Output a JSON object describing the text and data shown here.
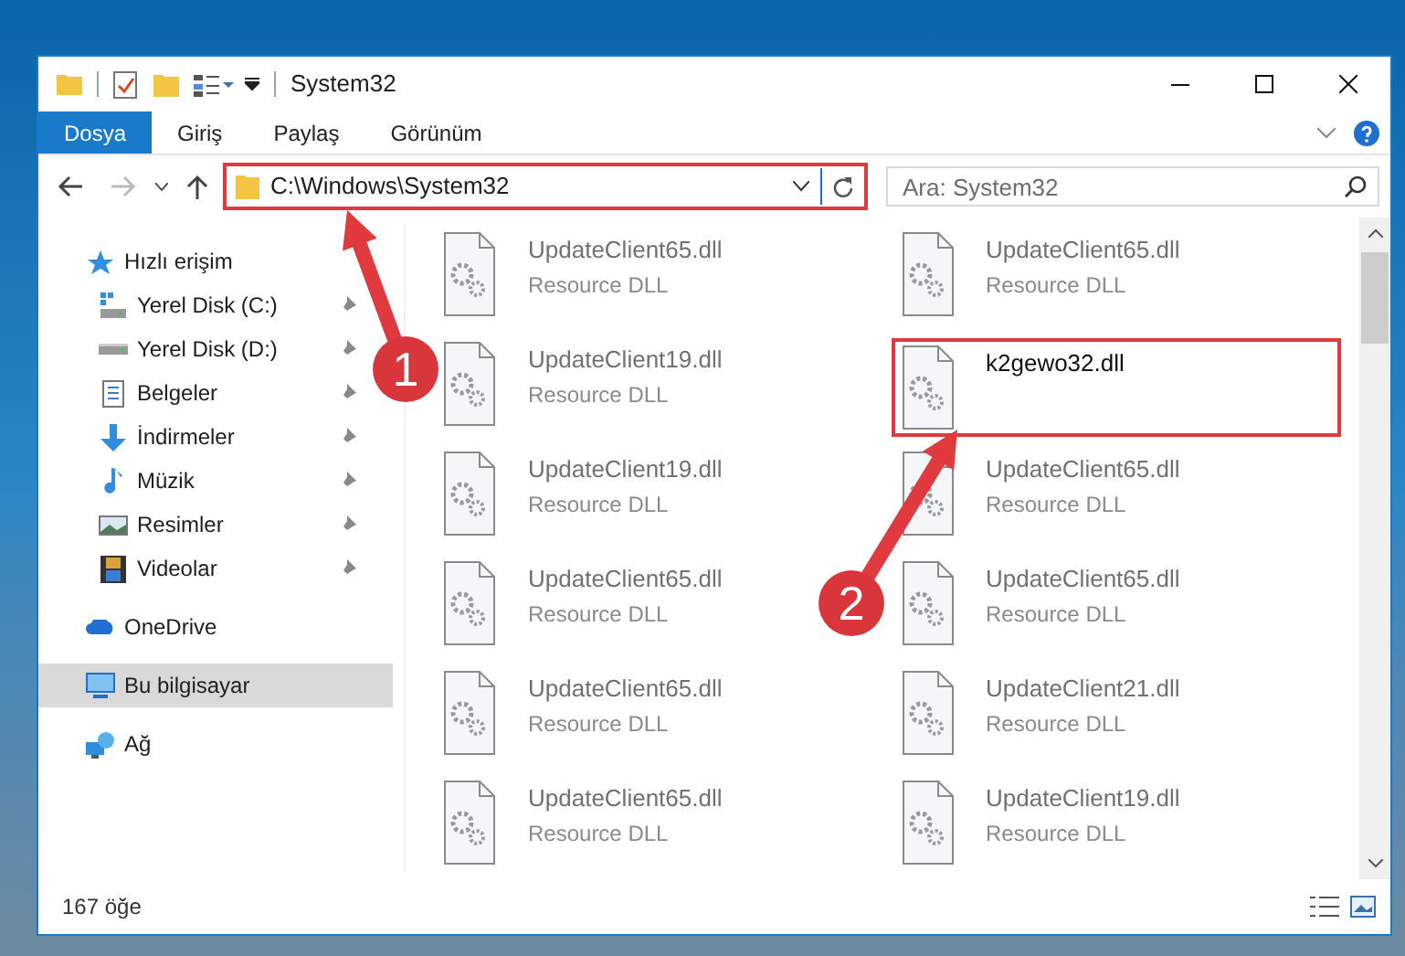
{
  "window": {
    "title": "System32"
  },
  "ribbon_tabs": [
    {
      "label": "Dosya",
      "kind": "file"
    },
    {
      "label": "Giriş",
      "kind": "tab"
    },
    {
      "label": "Paylaş",
      "kind": "tab"
    },
    {
      "label": "Görünüm",
      "kind": "tab"
    }
  ],
  "address_bar": {
    "path": "C:\\Windows\\System32",
    "highlighted": true
  },
  "search": {
    "placeholder": "Ara: System32"
  },
  "sidebar": {
    "items": [
      {
        "label": "Hızlı erişim",
        "selected": false,
        "children": [
          {
            "label": "Yerel Disk (C:)",
            "pinned": true,
            "selected": false
          },
          {
            "label": "Yerel Disk (D:)",
            "pinned": true,
            "selected": false
          },
          {
            "label": "Belgeler",
            "pinned": true,
            "selected": false
          },
          {
            "label": "İndirmeler",
            "pinned": true,
            "selected": false
          },
          {
            "label": "Müzik",
            "pinned": true,
            "selected": false
          },
          {
            "label": "Resimler",
            "pinned": true,
            "selected": false
          },
          {
            "label": "Videolar",
            "pinned": true,
            "selected": false
          }
        ]
      },
      {
        "label": "OneDrive",
        "selected": false
      },
      {
        "label": "Bu bilgisayar",
        "selected": true
      },
      {
        "label": "Ağ",
        "selected": false
      }
    ]
  },
  "files": [
    {
      "name": "UpdateClient65.dll",
      "type": "Resource DLL",
      "highlighted": false
    },
    {
      "name": "UpdateClient65.dll",
      "type": "Resource DLL",
      "highlighted": false
    },
    {
      "name": "UpdateClient19.dll",
      "type": "Resource DLL",
      "highlighted": false
    },
    {
      "name": "k2gewo32.dll",
      "highlighted": true
    },
    {
      "name": "UpdateClient19.dll",
      "type": "Resource DLL",
      "highlighted": false
    },
    {
      "name": "UpdateClient65.dll",
      "type": "Resource DLL",
      "highlighted": false
    },
    {
      "name": "UpdateClient65.dll",
      "type": "Resource DLL",
      "highlighted": false
    },
    {
      "name": "UpdateClient65.dll",
      "type": "Resource DLL",
      "highlighted": false
    },
    {
      "name": "UpdateClient65.dll",
      "type": "Resource DLL",
      "highlighted": false
    },
    {
      "name": "UpdateClient21.dll",
      "type": "Resource DLL",
      "highlighted": false
    },
    {
      "name": "UpdateClient65.dll",
      "type": "Resource DLL",
      "highlighted": false
    },
    {
      "name": "UpdateClient19.dll",
      "type": "Resource DLL",
      "highlighted": false
    }
  ],
  "status_bar": {
    "item_count": "167 öğe"
  },
  "annotations": [
    {
      "label": "1"
    },
    {
      "label": "2"
    }
  ]
}
